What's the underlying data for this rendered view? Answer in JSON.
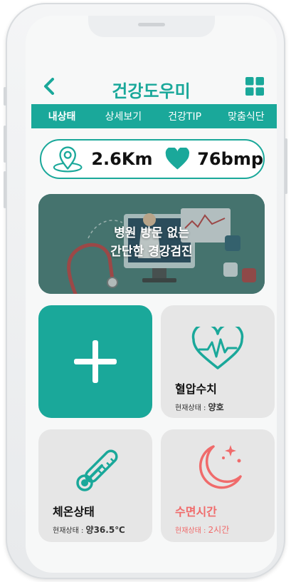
{
  "app": {
    "title": "건강도우미"
  },
  "tabs": [
    {
      "label": "내상태"
    },
    {
      "label": "상세보기"
    },
    {
      "label": "건강TIP"
    },
    {
      "label": "맞춤식단"
    }
  ],
  "stats": {
    "distance": "2.6Km",
    "heart_rate": "76bmp"
  },
  "banner": {
    "line1": "병원 방문 없는",
    "line2": "간단한 경강검진"
  },
  "cards": {
    "blood_pressure": {
      "title": "혈압수치",
      "status_label": "현재상태 :",
      "status_value": "양호"
    },
    "temperature": {
      "title": "체온상태",
      "status_label": "현재상태 :",
      "status_value": "양36.5℃"
    },
    "sleep": {
      "title": "수면시간",
      "status_label": "현재상태 :",
      "status_value": "2시간"
    }
  },
  "colors": {
    "accent": "#1aa89a",
    "sleep": "#f06b6b",
    "card_bg": "#e6e6e6"
  }
}
